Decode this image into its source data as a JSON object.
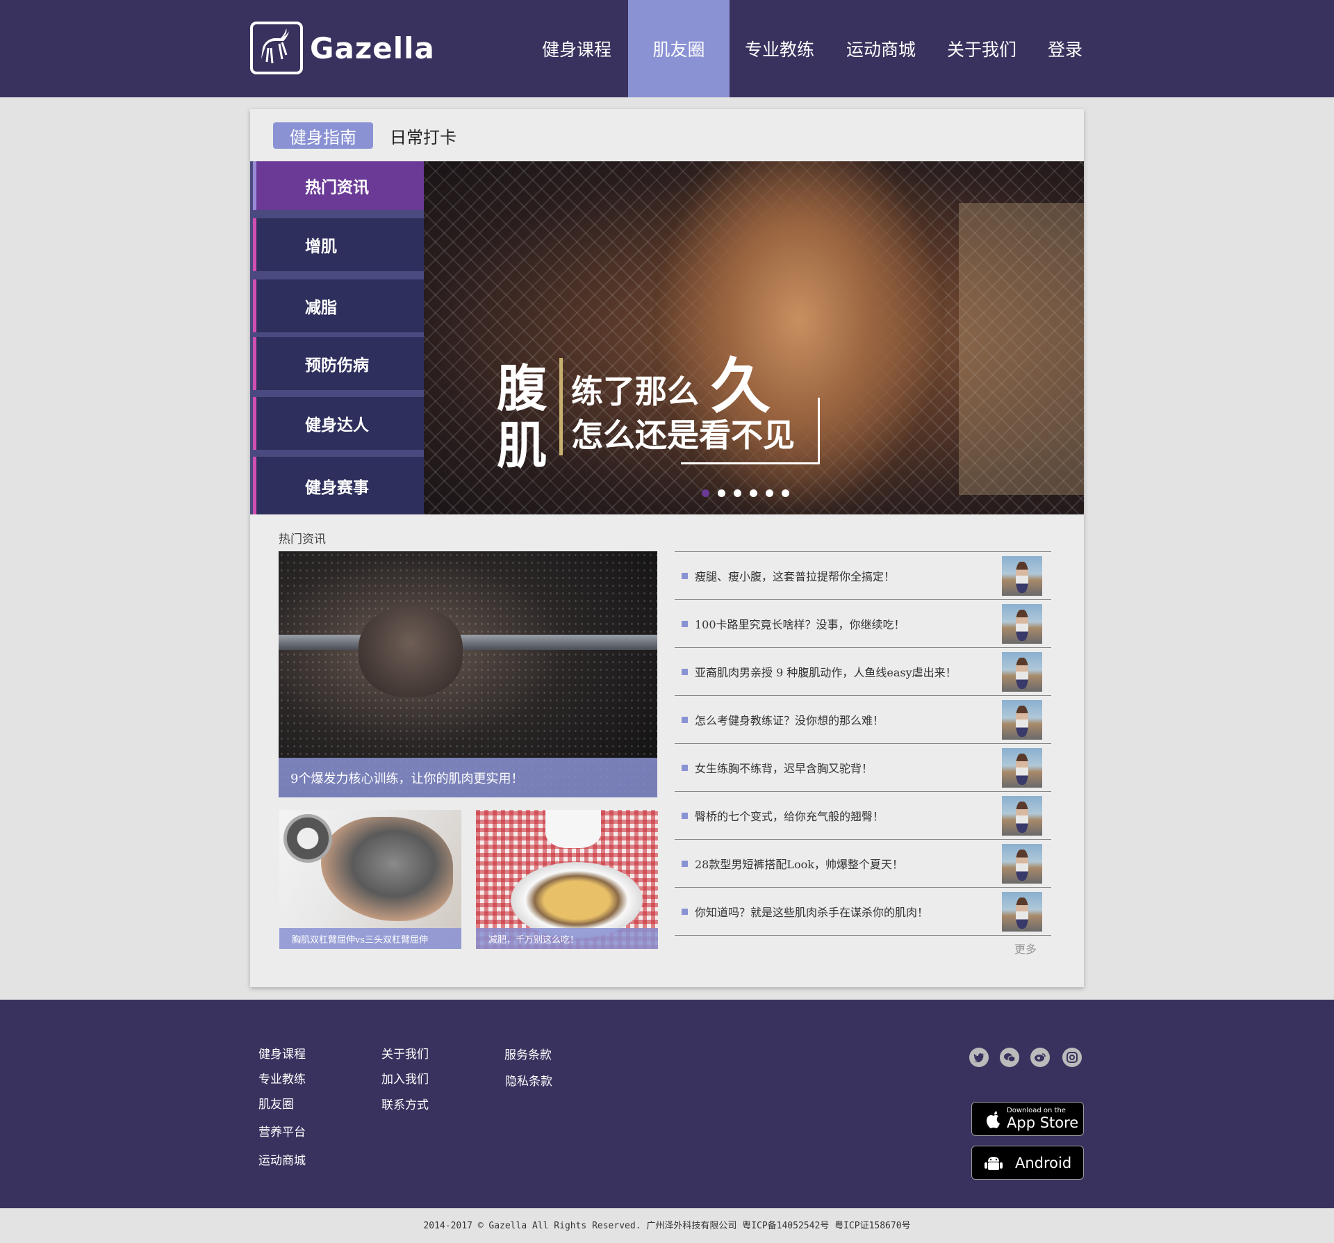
{
  "brand": {
    "name": "Gazella"
  },
  "nav": {
    "items": [
      {
        "label": "健身课程"
      },
      {
        "label": "肌友圈"
      },
      {
        "label": "专业教练"
      },
      {
        "label": "运动商城"
      },
      {
        "label": "关于我们"
      },
      {
        "label": "登录"
      }
    ],
    "active_index": 1
  },
  "tabs": {
    "items": [
      {
        "label": "健身指南"
      },
      {
        "label": "日常打卡"
      }
    ],
    "active_index": 0
  },
  "sidebar": {
    "items": [
      {
        "label": "热门资讯"
      },
      {
        "label": "增肌"
      },
      {
        "label": "减脂"
      },
      {
        "label": "预防伤病"
      },
      {
        "label": "健身达人"
      },
      {
        "label": "健身赛事"
      }
    ],
    "active_index": 0
  },
  "banner": {
    "char1": "腹",
    "char2": "肌",
    "line1": "练了那么",
    "line1_big": "久",
    "line2": "怎么还是看不见",
    "slides": 6,
    "active_slide": 0
  },
  "news": {
    "section_label": "热门资讯",
    "feature_caption": "9个爆发力核心训练，让你的肌肉更实用！",
    "thumb1_caption": "胸肌双杠臂屈伸vs三头双杠臂屈伸",
    "thumb2_caption": "减肥，千万别这么吃！",
    "list": [
      "瘦腿、瘦小腹，这套普拉提帮你全搞定！",
      "100卡路里究竟长啥样？没事，你继续吃！",
      "亚裔肌肉男亲授 9 种腹肌动作，人鱼线easy虐出来！",
      "怎么考健身教练证？没你想的那么难！",
      "女生练胸不练背，迟早含胸又驼背！",
      "臀桥的七个变式，给你充气般的翘臀！",
      "28款型男短裤搭配Look，帅爆整个夏天！",
      "你知道吗？就是这些肌肉杀手在谋杀你的肌肉！"
    ],
    "more_label": "更多"
  },
  "footer": {
    "col1": [
      "健身课程",
      "专业教练",
      "肌友圈",
      "营养平台",
      "运动商城"
    ],
    "col2": [
      "关于我们",
      "加入我们",
      "联系方式"
    ],
    "col3": [
      "服务条款",
      "隐私条款"
    ],
    "social": [
      "twitter-icon",
      "wechat-icon",
      "weibo-icon",
      "instagram-icon"
    ],
    "appstore_small": "Download on the",
    "appstore_big": "App Store",
    "android_label": "Android",
    "copyright": "2014-2017 © Gazella All Rights Reserved. 广州泽外科技有限公司 粤ICP备14052542号 粤ICP证158670号"
  },
  "colors": {
    "header_bg": "#3a325e",
    "accent": "#8a92d4",
    "sidebar_active": "#6a3a96",
    "sidebar_item": "#2e2f5c",
    "sidebar_marker": "#d24fb0"
  }
}
